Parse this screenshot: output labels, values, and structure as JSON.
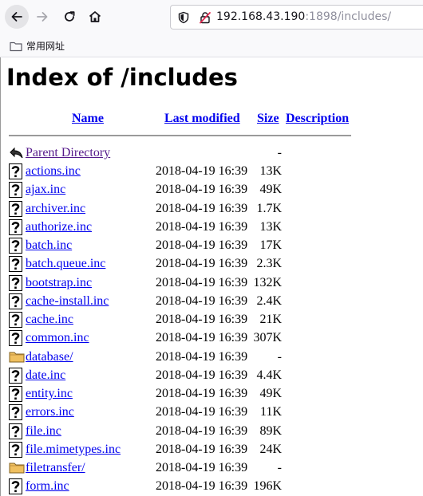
{
  "browser": {
    "url_host": "192.168.43.190",
    "url_rest": ":1898/includes/",
    "bookmark_label": "常用网址"
  },
  "page": {
    "title": "Index of /includes",
    "headers": {
      "name": "Name",
      "last_modified": "Last modified",
      "size": "Size",
      "description": "Description"
    },
    "parent": {
      "name": "Parent Directory",
      "size": "-"
    },
    "rows": [
      {
        "name": "actions.inc",
        "date": "2018-04-19 16:39",
        "size": "13K",
        "type": "file"
      },
      {
        "name": "ajax.inc",
        "date": "2018-04-19 16:39",
        "size": "49K",
        "type": "file"
      },
      {
        "name": "archiver.inc",
        "date": "2018-04-19 16:39",
        "size": "1.7K",
        "type": "file"
      },
      {
        "name": "authorize.inc",
        "date": "2018-04-19 16:39",
        "size": "13K",
        "type": "file"
      },
      {
        "name": "batch.inc",
        "date": "2018-04-19 16:39",
        "size": "17K",
        "type": "file"
      },
      {
        "name": "batch.queue.inc",
        "date": "2018-04-19 16:39",
        "size": "2.3K",
        "type": "file"
      },
      {
        "name": "bootstrap.inc",
        "date": "2018-04-19 16:39",
        "size": "132K",
        "type": "file"
      },
      {
        "name": "cache-install.inc",
        "date": "2018-04-19 16:39",
        "size": "2.4K",
        "type": "file"
      },
      {
        "name": "cache.inc",
        "date": "2018-04-19 16:39",
        "size": "21K",
        "type": "file"
      },
      {
        "name": "common.inc",
        "date": "2018-04-19 16:39",
        "size": "307K",
        "type": "file"
      },
      {
        "name": "database/",
        "date": "2018-04-19 16:39",
        "size": "-",
        "type": "folder"
      },
      {
        "name": "date.inc",
        "date": "2018-04-19 16:39",
        "size": "4.4K",
        "type": "file"
      },
      {
        "name": "entity.inc",
        "date": "2018-04-19 16:39",
        "size": "49K",
        "type": "file"
      },
      {
        "name": "errors.inc",
        "date": "2018-04-19 16:39",
        "size": "11K",
        "type": "file"
      },
      {
        "name": "file.inc",
        "date": "2018-04-19 16:39",
        "size": "89K",
        "type": "file"
      },
      {
        "name": "file.mimetypes.inc",
        "date": "2018-04-19 16:39",
        "size": "24K",
        "type": "file"
      },
      {
        "name": "filetransfer/",
        "date": "2018-04-19 16:39",
        "size": "-",
        "type": "folder"
      },
      {
        "name": "form.inc",
        "date": "2018-04-19 16:39",
        "size": "196K",
        "type": "file"
      }
    ]
  }
}
